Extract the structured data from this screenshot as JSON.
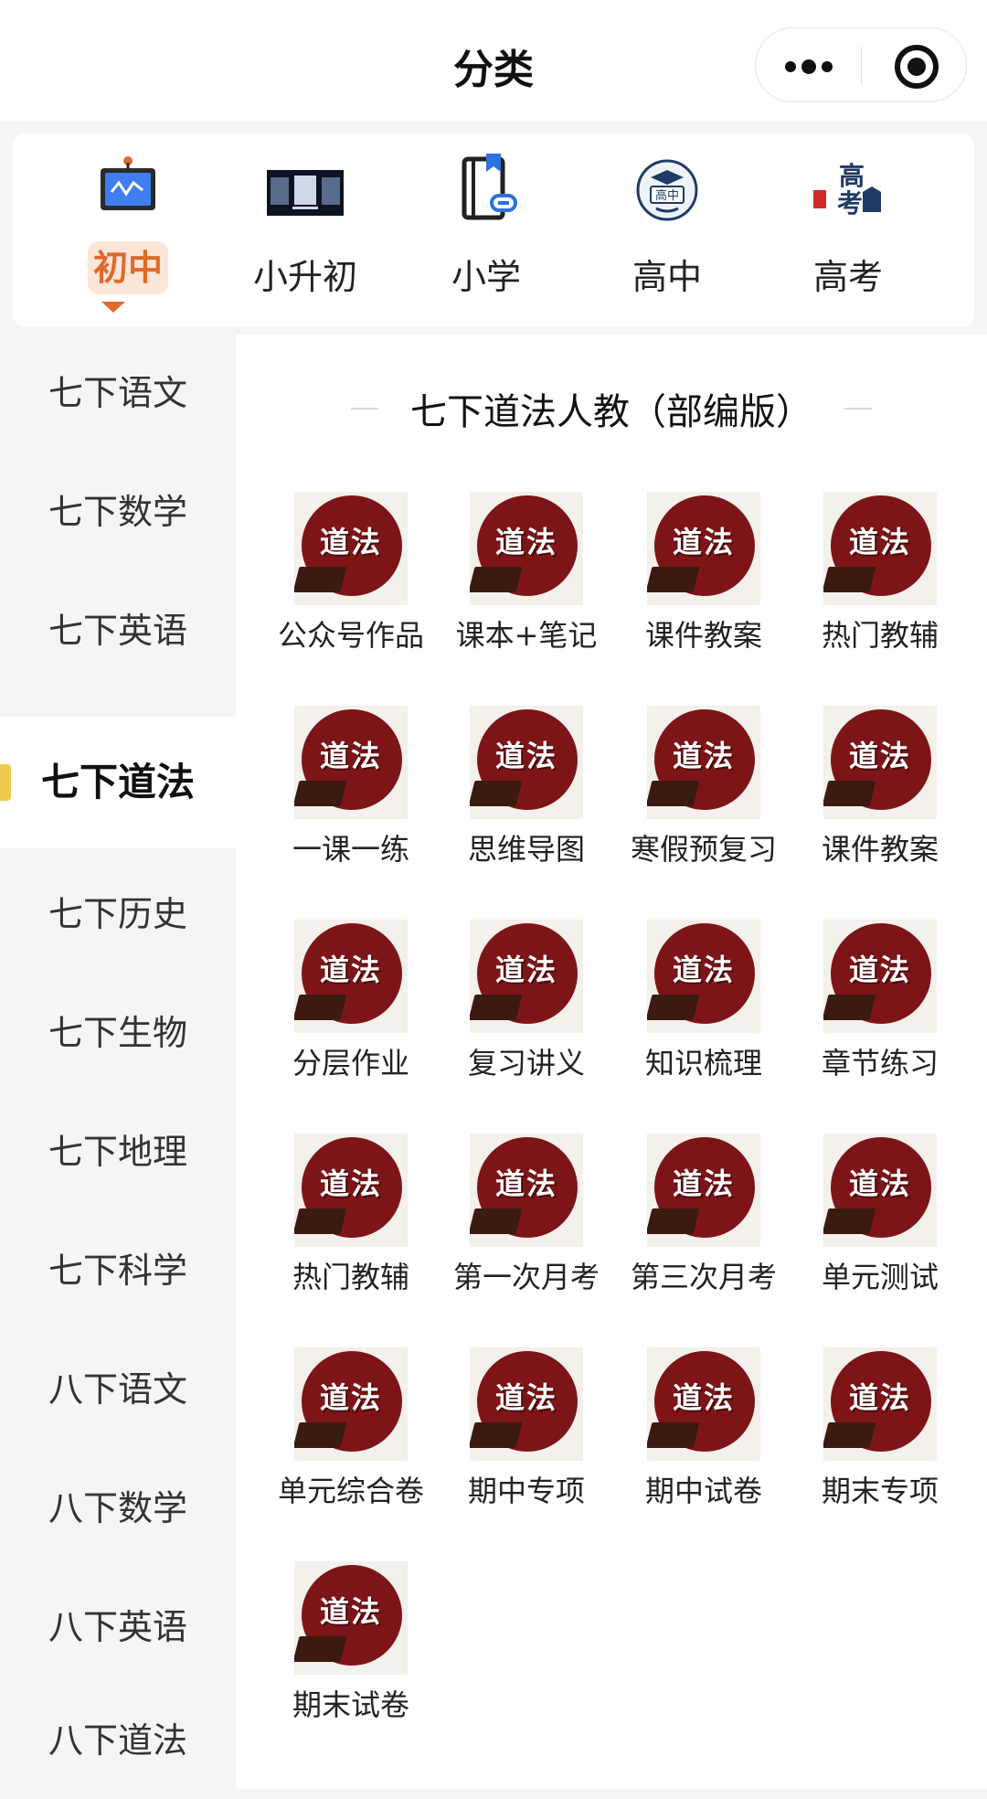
{
  "navbar": {
    "title": "分类"
  },
  "stages": [
    {
      "label": "初中",
      "icon": "teaching-board-icon",
      "active": true
    },
    {
      "label": "小升初",
      "icon": "promo-banner-image"
    },
    {
      "label": "小学",
      "icon": "bookmark-book-link-icon"
    },
    {
      "label": "高中",
      "icon": "graduation-cap-badge-icon"
    },
    {
      "label": "高考",
      "icon": "gaokao-logo-image"
    }
  ],
  "sidebar": {
    "items": [
      "七下语文",
      "七下数学",
      "七下英语",
      "七下道法",
      "七下历史",
      "七下生物",
      "七下地理",
      "七下科学",
      "八下语文",
      "八下数学",
      "八下英语",
      "八下道法"
    ],
    "active_index": 3
  },
  "content": {
    "section_title": "七下道法人教（部编版）",
    "tile_icon_text": "道法",
    "tiles": [
      "公众号作品",
      "课本+笔记",
      "课件教案",
      "热门教辅",
      "一课一练",
      "思维导图",
      "寒假预复习",
      "课件教案",
      "分层作业",
      "复习讲义",
      "知识梳理",
      "章节练习",
      "热门教辅",
      "第一次月考",
      "第三次月考",
      "单元测试",
      "单元综合卷",
      "期中专项",
      "期中试卷",
      "期末专项",
      "期末试卷"
    ]
  },
  "colors": {
    "accent": "#e0692b",
    "accent_bg": "#fce6d8",
    "sidebar_marker": "#f2c94c",
    "icon_circle": "#7d1518"
  }
}
